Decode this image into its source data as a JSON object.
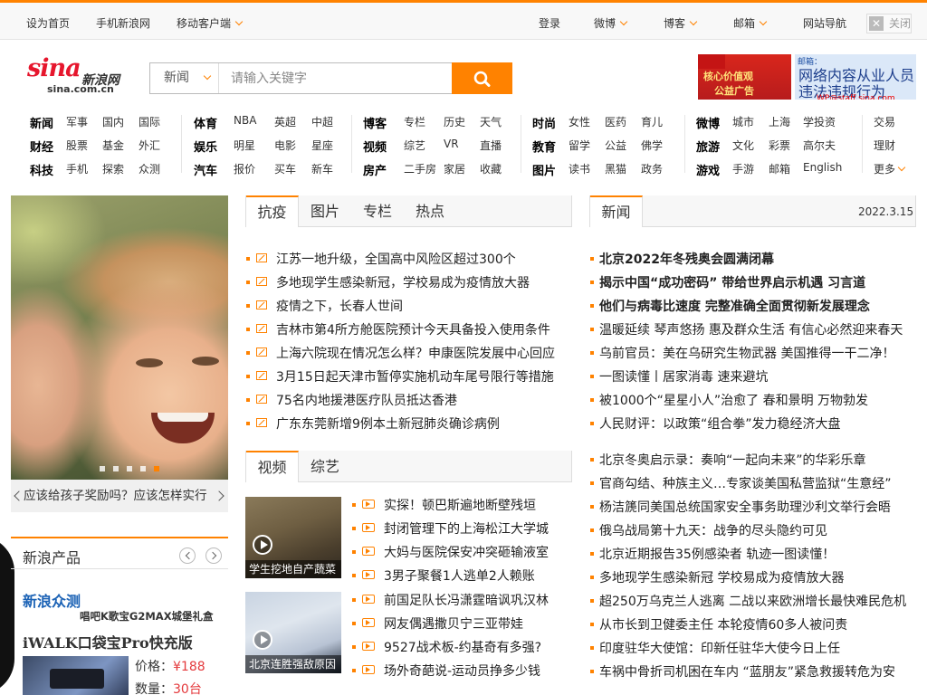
{
  "topbar": {
    "set_home": "设为首页",
    "mobile_sina": "手机新浪网",
    "mobile_client": "移动客户端",
    "login": "登录",
    "weibo": "微博",
    "blog": "博客",
    "mail": "邮箱",
    "site_nav": "网站导航",
    "close": "关闭"
  },
  "logo": {
    "main": "sina",
    "cn": "新浪网",
    "domain": "sina.com.cn"
  },
  "search": {
    "category": "新闻",
    "placeholder": "请输入关键字"
  },
  "banner_ad": {
    "left_line1": "核心价值观",
    "left_line2": "公益广告",
    "right_top": "邮箱：",
    "right_line1": "网络内容从业人员",
    "right_line2": "违法违规行为",
    "right_line3": "WP@staff.sina.com"
  },
  "nav": {
    "col1": [
      [
        "新闻",
        "军事",
        "国内",
        "国际"
      ],
      [
        "财经",
        "股票",
        "基金",
        "外汇"
      ],
      [
        "科技",
        "手机",
        "探索",
        "众测"
      ]
    ],
    "col2": [
      [
        "体育",
        "NBA",
        "英超",
        "中超"
      ],
      [
        "娱乐",
        "明星",
        "电影",
        "星座"
      ],
      [
        "汽车",
        "报价",
        "买车",
        "新车"
      ]
    ],
    "col3": [
      [
        "博客",
        "专栏",
        "历史",
        "天气"
      ],
      [
        "视频",
        "综艺",
        "VR",
        "直播"
      ],
      [
        "房产",
        "二手房",
        "家居",
        "收藏"
      ]
    ],
    "col4": [
      [
        "时尚",
        "女性",
        "医药",
        "育儿"
      ],
      [
        "教育",
        "留学",
        "公益",
        "佛学"
      ],
      [
        "图片",
        "读书",
        "黑猫",
        "政务"
      ]
    ],
    "col5": [
      [
        "微博",
        "城市",
        "上海",
        "学投资"
      ],
      [
        "旅游",
        "文化",
        "彩票",
        "高尔夫"
      ],
      [
        "游戏",
        "手游",
        "邮箱",
        "English"
      ]
    ],
    "col6": [
      "交易",
      "理财",
      "更多"
    ]
  },
  "slideshow": {
    "caption": "应该给孩子奖励吗？应该怎样实行",
    "dot_count": 5,
    "active_dot": 4
  },
  "products": {
    "title": "新浪产品",
    "sub_title": "新浪众测",
    "promo": "唱吧K歌宝G2MAX城堡礼盒",
    "product_name": "iWALK口袋宝Pro快充版",
    "price_label": "价格：",
    "price_value": "¥188",
    "qty_label": "数量：",
    "qty_value": "30台"
  },
  "tabs1": [
    "抗疫",
    "图片",
    "专栏",
    "热点"
  ],
  "list1": [
    "江苏一地升级，全国高中风险区超过300个",
    "多地现学生感染新冠，学校易成为疫情放大器",
    "疫情之下，长春人世间",
    "吉林市第4所方舱医院预计今天具备投入使用条件",
    "上海六院现在情况怎么样？申康医院发展中心回应",
    "3月15日起天津市暂停实施机动车尾号限行等措施",
    "75名内地援港医疗队员抵达香港",
    "广东东莞新增9例本土新冠肺炎确诊病例"
  ],
  "tabs2": [
    "视频",
    "综艺"
  ],
  "videos": [
    {
      "caption": "学生挖地自产蔬菜",
      "items": [
        "实探！顿巴斯遍地断壁残垣",
        "封闭管理下的上海松江大学城",
        "大妈与医院保安冲突砸输液室",
        "3男子聚餐1人逃单2人赖账"
      ]
    },
    {
      "caption": "北京连胜强敌原因",
      "items": [
        "前国足队长冯潇霆暗讽巩汉林",
        "网友偶遇撒贝宁三亚带娃",
        "9527战术板-约基奇有多强?",
        "场外奇葩说-运动员挣多少钱"
      ]
    }
  ],
  "news_tab": "新闻",
  "news_date": "2022.3.15",
  "news_bold": [
    "北京2022年冬残奥会圆满闭幕",
    "揭示中国“成功密码” 带给世界启示机遇 习言道",
    "他们与病毒比速度 完整准确全面贯彻新发展理念"
  ],
  "news_block1": [
    "温暖延续 琴声悠扬 惠及群众生活 有信心必然迎来春天",
    "乌前官员：美在乌研究生物武器 美国推得一干二净！",
    "一图读懂丨居家消毒 速来避坑",
    "被1000个“星星小人”治愈了 春和景明 万物勃发",
    "人民财评：以政策“组合拳”发力稳经济大盘"
  ],
  "news_block2": [
    "北京冬奥启示录：奏响“一起向未来”的华彩乐章",
    "官商勾结、种族主义…专家谈美国私营监狱“生意经”",
    "杨洁篪同美国总统国家安全事务助理沙利文举行会晤",
    "俄乌战局第十九天：战争的尽头隐约可见",
    "北京近期报告35例感染者 轨迹一图读懂！",
    "多地现学生感染新冠 学校易成为疫情放大器",
    "超250万乌克兰人逃离 二战以来欧洲增长最快难民危机",
    "从市长到卫健委主任 本轮疫情60多人被问责",
    "印度驻华大使馆：印新任驻华大使今日上任",
    "车祸中骨折司机困在车内 “蓝朋友”紧急救援转危为安"
  ],
  "colors": {
    "accent": "#ff8200",
    "brand_red": "#e6162d",
    "link_blue": "#1b62b5"
  }
}
